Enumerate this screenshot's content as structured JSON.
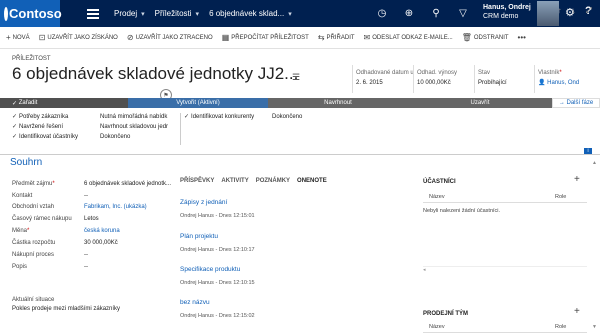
{
  "topbar": {
    "logo_text": "Contoso",
    "nav": [
      "Prodej",
      "Příležitosti",
      "6 objednávek sklad..."
    ],
    "user_name": "Hanus, Ondrej",
    "user_org": "CRM demo",
    "brand_color": "#002050"
  },
  "commands": [
    {
      "icon": "plus-icon",
      "label": "NOVÁ"
    },
    {
      "icon": "save-won-icon",
      "label": "UZAVŘÍT JAKO ZÍSKÁNO"
    },
    {
      "icon": "close-lost-icon",
      "label": "UZAVŘÍT JAKO ZTRACENO"
    },
    {
      "icon": "recalculate-icon",
      "label": "PŘEPOČÍTAT PŘÍLEŽITOST"
    },
    {
      "icon": "assign-icon",
      "label": "PŘIŘADIT"
    },
    {
      "icon": "email-link-icon",
      "label": "ODESLAT ODKAZ E-MAILE..."
    },
    {
      "icon": "delete-icon",
      "label": "ODSTRANIT"
    }
  ],
  "header": {
    "entity_type": "PŘÍLEŽITOST",
    "title": "6 objednávek skladové jednotky JJ2...",
    "fields": [
      {
        "label": "Odhadované datum u",
        "value": "2. 6. 2015"
      },
      {
        "label": "Odhad. výnosy",
        "value": "10 000,00Kč"
      },
      {
        "label": "Stav",
        "value": "Probíhající"
      },
      {
        "label": "Vlastník",
        "value": "Hanus, Ond"
      }
    ]
  },
  "process": {
    "stages": [
      "Zařadit",
      "Vytvořit (Aktivní)",
      "Navrhnout",
      "Uzavřít"
    ],
    "next_stage": "Další fáze",
    "steps_col1": [
      "Potřeby zákazníka",
      "Navržené řešení",
      "Identifikovat účastníky"
    ],
    "steps_col2": [
      "Nutná mimořádná nabídk",
      "Navrhnout skladovou jedr",
      "Dokončeno"
    ],
    "steps_col3": [
      "Identifikovat konkurenty"
    ],
    "steps_col4": [
      "Dokončeno"
    ]
  },
  "summary": {
    "title": "Souhrn",
    "fields": [
      {
        "label": "Předmět zájmu",
        "value": "6 objednávek skladové jednotk...",
        "required": true,
        "link": false
      },
      {
        "label": "Kontakt",
        "value": "--",
        "required": false,
        "link": false
      },
      {
        "label": "Obchodní vztah",
        "value": "Fabrikam, Inc. (ukázka)",
        "required": false,
        "link": true
      },
      {
        "label": "Časový rámec nákupu",
        "value": "Letos",
        "required": false,
        "link": false
      },
      {
        "label": "Měna",
        "value": "česká koruna",
        "required": true,
        "link": true
      },
      {
        "label": "Částka rozpočtu",
        "value": "30 000,00Kč",
        "required": false,
        "link": false
      },
      {
        "label": "Nákupní proces",
        "value": "--",
        "required": false,
        "link": false
      },
      {
        "label": "Popis",
        "value": "--",
        "required": false,
        "link": false
      }
    ],
    "situation_label": "Aktuální situace",
    "situation_value": "Pokles prodeje mezi mladšími zákazníky"
  },
  "activity": {
    "tabs": [
      "PŘÍSPĚVKY",
      "AKTIVITY",
      "POZNÁMKY",
      "ONENOTE"
    ],
    "active_tab": "ONENOTE",
    "notes": [
      {
        "title": "Zápisy z jednání",
        "meta": "Ondrej Hanus - Dnes 12:15:01"
      },
      {
        "title": "Plán projektu",
        "meta": "Ondrej Hanus - Dnes 12:10:17"
      },
      {
        "title": "Specifikace produktu",
        "meta": "Ondrej Hanus - Dnes 12:10:15"
      },
      {
        "title": "bez názvu",
        "meta": "Ondrej Hanus - Dnes 12:15:02"
      }
    ]
  },
  "stakeholders": {
    "title": "ÚČASTNÍCI",
    "col_name": "Název",
    "col_role": "Role",
    "empty": "Nebyli nalezeni žádní účastníci."
  },
  "sales_team": {
    "title": "PRODEJNÍ TÝM",
    "col_name": "Název",
    "col_role": "Role"
  }
}
